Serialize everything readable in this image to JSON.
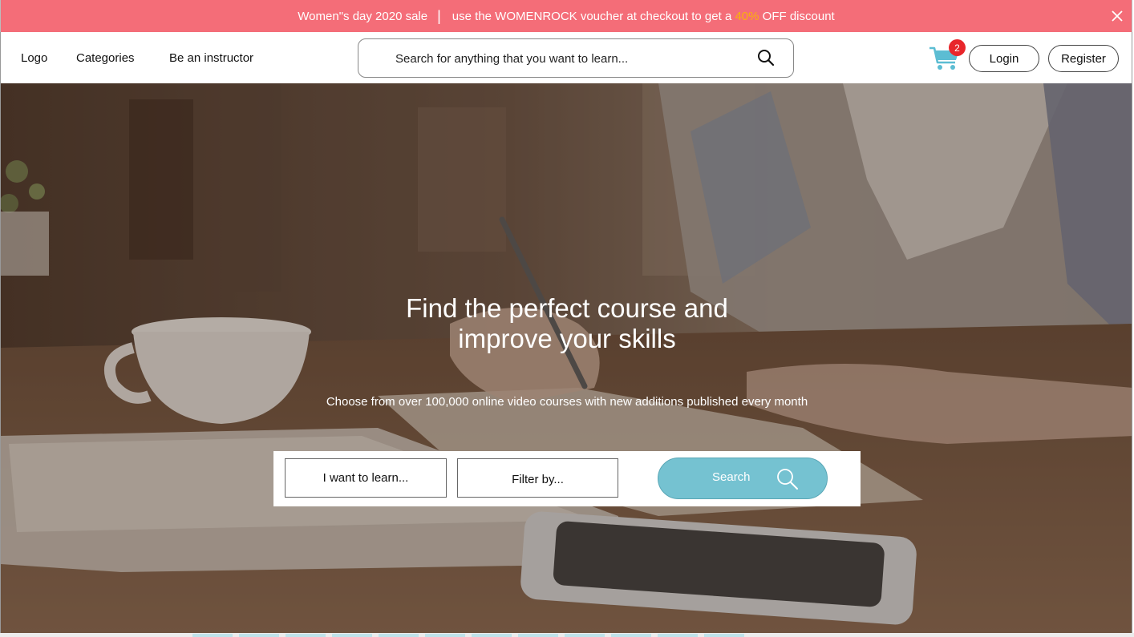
{
  "promo": {
    "sale_text": "Women\"s day 2020 sale",
    "separator": "|",
    "msg_before": "use the WOMENROCK voucher at checkout to get a",
    "highlight": "40%",
    "msg_after": "OFF discount",
    "highlight_color": "#f9b20a",
    "background": "#f46d78"
  },
  "nav": {
    "logo": "Logo",
    "categories": "Categories",
    "instructor": "Be an instructor",
    "search_placeholder": "Search for anything that you want to learn...",
    "cart_count": "2",
    "login": "Login",
    "register": "Register"
  },
  "hero": {
    "title_line1": "Find the perfect course and",
    "title_line2": "improve your skills",
    "subtitle": "Choose from over 100,000 online video courses with new additions published every month",
    "learn_field": "I want to learn...",
    "filter_field": "Filter by...",
    "search_button": "Search",
    "accent": "#75c2d1"
  },
  "icons": [
    "close-icon",
    "search-icon",
    "cart-icon"
  ]
}
